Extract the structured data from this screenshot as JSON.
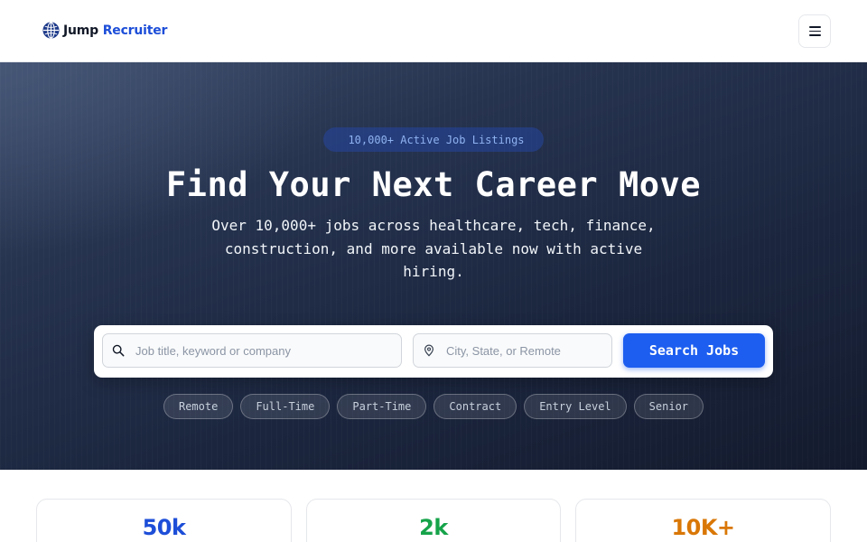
{
  "header": {
    "logo_part1": "Jump",
    "logo_part2": "Recruiter",
    "logo_icon": "globe-icon",
    "menu_icon": "hamburger-icon"
  },
  "hero": {
    "badge_icon": "",
    "badge_text": "10,000+ Active Job Listings",
    "title": "Find Your Next Career Move",
    "subtitle": "Over 10,000+ jobs across healthcare, tech, finance, construction, and more available now with active hiring."
  },
  "search": {
    "job_placeholder": "Job title, keyword or company",
    "job_value": "",
    "location_placeholder": "City, State, or Remote",
    "location_value": "",
    "button_label": "Search Jobs"
  },
  "filters": [
    "Remote",
    "Full-Time",
    "Part-Time",
    "Contract",
    "Entry Level",
    "Senior"
  ],
  "stats": [
    {
      "value": "50k",
      "color": "#1d4ed8"
    },
    {
      "value": "2k",
      "color": "#16a34a"
    },
    {
      "value": "10K+",
      "color": "#d97706"
    }
  ],
  "colors": {
    "accent": "#1d5ef0",
    "brand": "#1d4ed8"
  }
}
